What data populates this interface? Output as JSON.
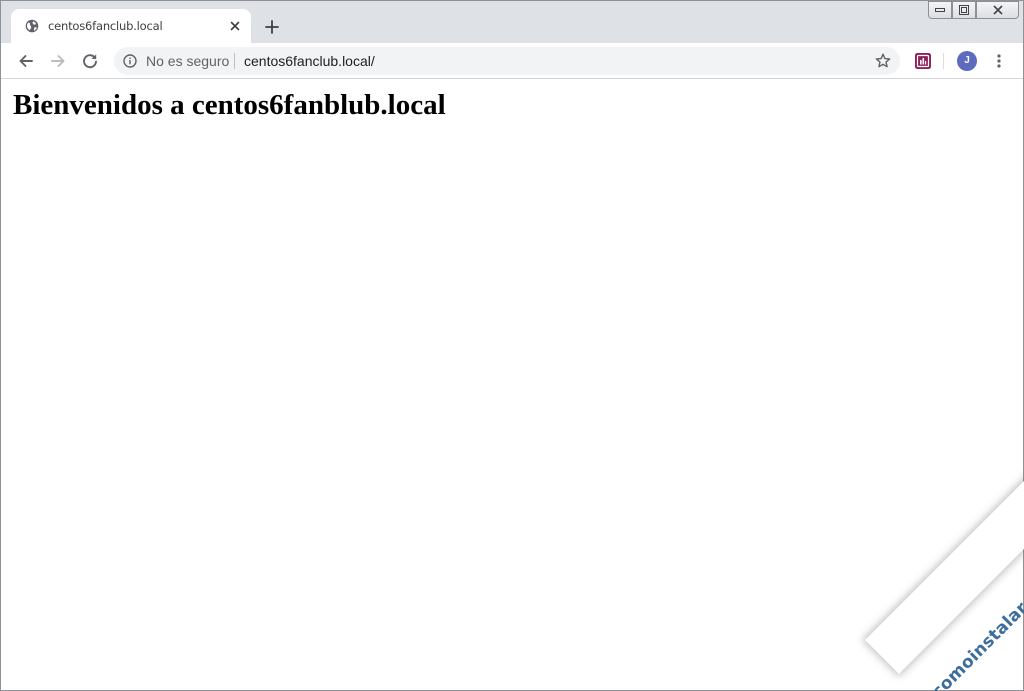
{
  "browser": {
    "tab": {
      "title": "centos6fanclub.local",
      "favicon": "globe-icon"
    },
    "new_tab_icon": "plus-icon",
    "window_controls": [
      "minimize-icon",
      "maximize-icon",
      "close-icon"
    ],
    "toolbar": {
      "back_icon": "arrow-left-icon",
      "forward_icon": "arrow-right-icon",
      "reload_icon": "reload-icon",
      "security_icon": "info-icon",
      "security_text": "No es seguro",
      "url": "centos6fanclub.local/",
      "bookmark_icon": "star-icon",
      "extension_icon": "extension-icon",
      "profile_initial": "J",
      "menu_icon": "kebab-menu-icon"
    }
  },
  "page": {
    "heading": "Bienvenidos a centos6fanblub.local"
  },
  "watermark": {
    "text": "comoinstalar.me",
    "color": "#3d6d9c"
  },
  "colors": {
    "tabstrip": "#dee1e6",
    "omnibox": "#f1f3f4",
    "avatar": "#5c6bc0",
    "extension": "#8e1f5a"
  }
}
